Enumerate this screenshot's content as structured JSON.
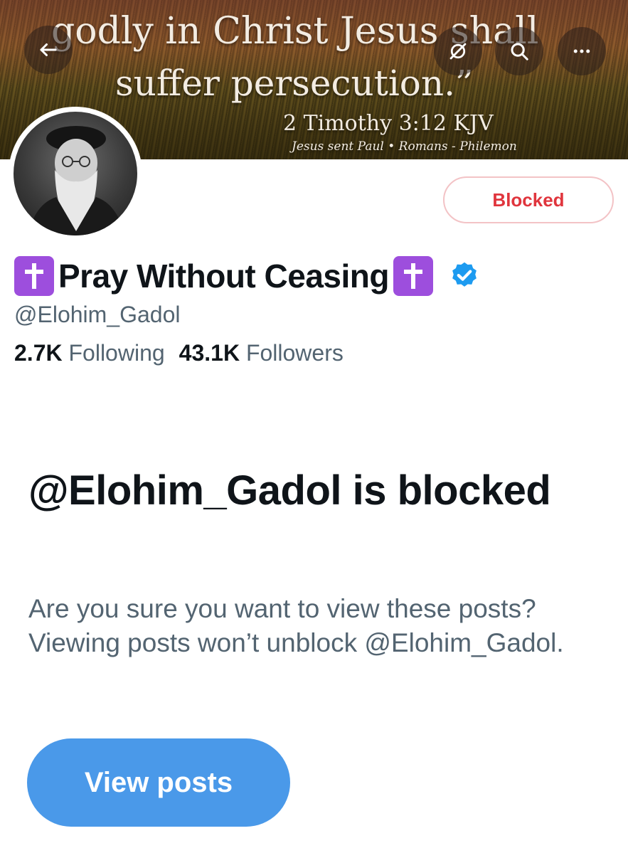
{
  "banner": {
    "quote_line1": "godly in Christ Jesus shall",
    "quote_line2": "suffer persecution.”",
    "reference": "2 Timothy 3:12 KJV",
    "tagline": "Jesus sent Paul • Romans - Philemon"
  },
  "header_icons": {
    "back": "arrow-left-icon",
    "sync": "sync-off-icon",
    "search": "search-icon",
    "more": "more-icon"
  },
  "profile": {
    "name_prefix_emoji": "✝️",
    "display_name": "Pray Without Ceasing",
    "name_suffix_emoji": "✝️",
    "handle": "@Elohim_Gadol",
    "following_count": "2.7K",
    "following_label": "Following",
    "followers_count": "43.1K",
    "followers_label": "Followers",
    "blocked_button": "Blocked"
  },
  "blocked_notice": {
    "title": "@Elohim_Gadol is blocked",
    "description": "Are you sure you want to view these posts? Viewing posts won’t unblock @Elohim_Gadol.",
    "view_button": "View posts"
  },
  "colors": {
    "accent": "#4a99e9",
    "blocked_red": "#e0353d",
    "verified_blue": "#1d9bf0",
    "cross_purple": "#9d4edd"
  }
}
